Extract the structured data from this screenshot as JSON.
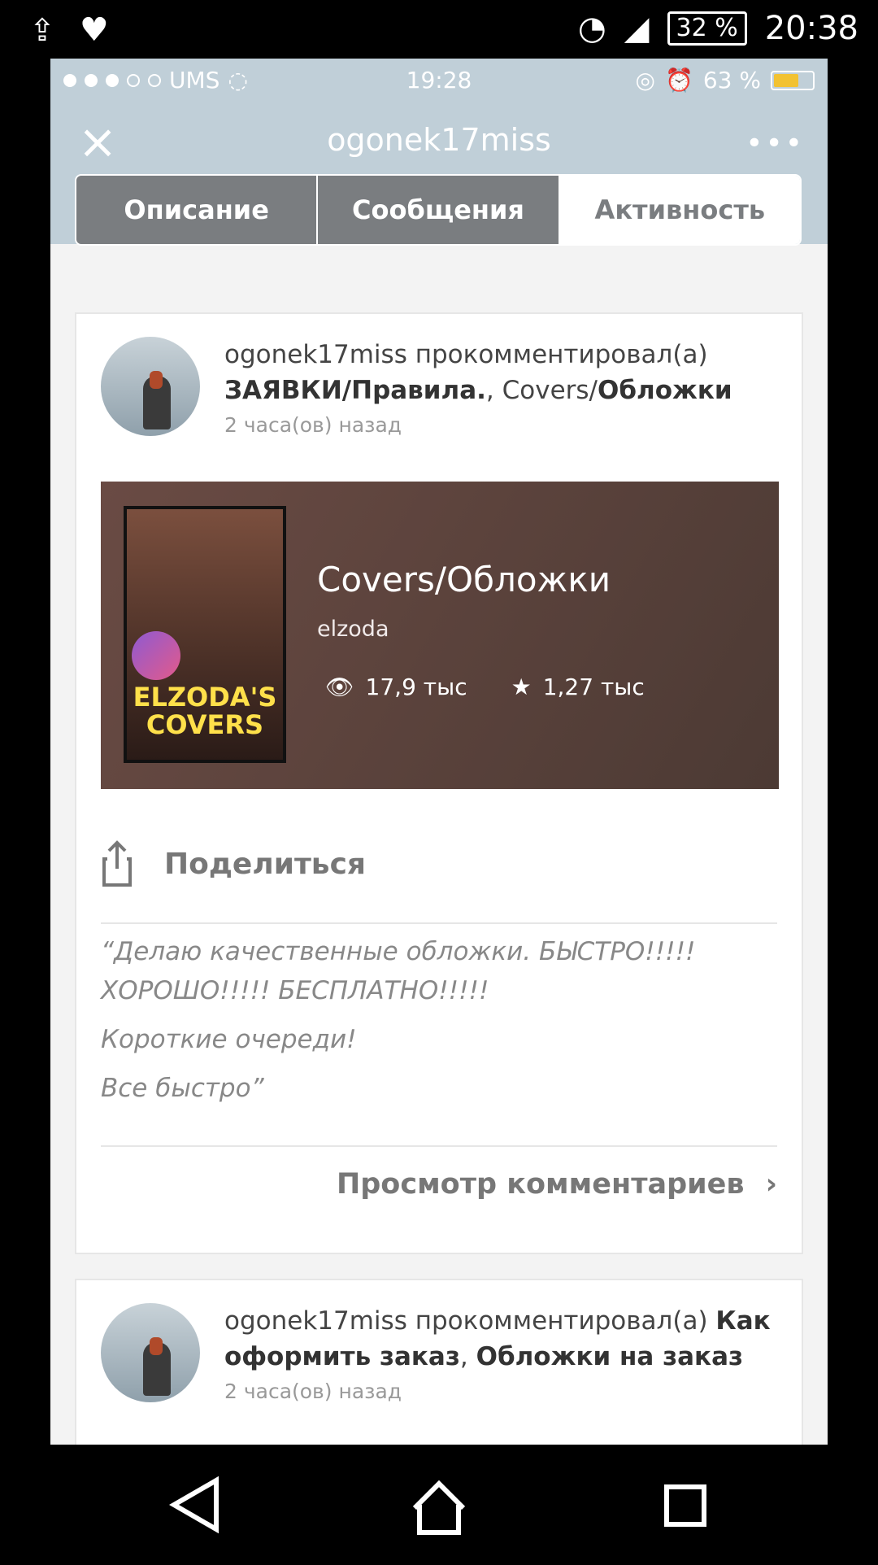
{
  "android_status": {
    "battery": "32 %",
    "time": "20:38"
  },
  "ios_status": {
    "carrier": "UMS",
    "time": "19:28",
    "battery": "63 %"
  },
  "header": {
    "title": "ogonek17miss"
  },
  "tabs": [
    {
      "label": "Описание",
      "active": false
    },
    {
      "label": "Сообщения",
      "active": false
    },
    {
      "label": "Активность",
      "active": true
    }
  ],
  "activity1": {
    "user": "ogonek17miss",
    "action": "прокомментировал(а)",
    "target1": "ЗАЯВКИ/Правила.",
    "sep": ", Covers/",
    "target2": "Обложки",
    "time": "2 часа(ов) назад",
    "story": {
      "title": "Covers/Обложки",
      "author": "elzoda",
      "views": "17,9 тыс",
      "votes": "1,27 тыс",
      "cover_text": "ELZODA'S COVERS"
    },
    "share_label": "Поделиться",
    "quote": [
      "“Делаю качественные обложки. БЫСТРО!!!!! ХОРОШО!!!!! БЕСПЛАТНО!!!!!",
      "Короткие очереди!",
      "Все быстро”"
    ],
    "comments_label": "Просмотр комментариев"
  },
  "activity2": {
    "user": "ogonek17miss",
    "action": "прокомментировал(а)",
    "target1": "Как оформить заказ",
    "sep": ",",
    "target2": "Обложки на заказ",
    "time": "2 часа(ов) назад"
  }
}
